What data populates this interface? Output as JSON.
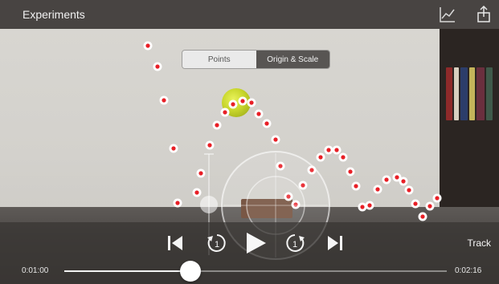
{
  "topbar": {
    "title": "Experiments",
    "graph_icon": "line-graph-icon",
    "share_icon": "share-icon"
  },
  "segmented": {
    "options": [
      "Points",
      "Origin & Scale"
    ],
    "selected": "Origin & Scale"
  },
  "playback": {
    "track_label": "Track",
    "time_current": "0:01:00",
    "time_total": "0:02:16",
    "progress": 0.33,
    "buttons": [
      "skip-to-start-icon",
      "step-back-icon",
      "play-icon",
      "step-forward-icon",
      "skip-to-end-icon"
    ],
    "step_back_label": "1",
    "step_forward_label": "1"
  },
  "colors": {
    "marker": "#e81f26",
    "accent": "#ffffff",
    "bar": "#3c3937"
  }
}
